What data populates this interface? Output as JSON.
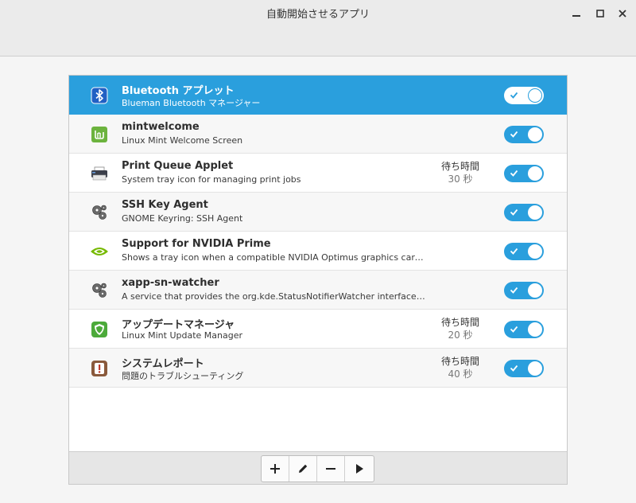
{
  "window": {
    "title": "自動開始させるアプリ",
    "buttons": {
      "minimize_icon": "minimize-icon",
      "maximize_icon": "maximize-icon",
      "close_icon": "close-icon"
    }
  },
  "apps": [
    {
      "name": "Bluetooth アプレット",
      "description": "Blueman Bluetooth マネージャー",
      "icon": "bluetooth-icon",
      "enabled": true,
      "selected": true
    },
    {
      "name": "mintwelcome",
      "description": "Linux Mint Welcome Screen",
      "icon": "mintwelcome-icon",
      "enabled": true
    },
    {
      "name": "Print Queue Applet",
      "description": "System tray icon for managing print jobs",
      "icon": "printer-icon",
      "enabled": true,
      "delay_label": "待ち時間",
      "delay_value": "30 秒"
    },
    {
      "name": "SSH Key Agent",
      "description": "GNOME Keyring: SSH Agent",
      "icon": "gears-icon",
      "enabled": true
    },
    {
      "name": "Support for NVIDIA Prime",
      "description": "Shows a tray icon when a compatible NVIDIA Optimus graphics card is de…",
      "icon": "nvidia-icon",
      "enabled": true
    },
    {
      "name": "xapp-sn-watcher",
      "description": "A service that provides the org.kde.StatusNotifierWatcher interface for XA…",
      "icon": "gears-icon",
      "enabled": true
    },
    {
      "name": "アップデートマネージャ",
      "description": "Linux Mint Update Manager",
      "icon": "shield-icon",
      "enabled": true,
      "delay_label": "待ち時間",
      "delay_value": "20 秒"
    },
    {
      "name": "システムレポート",
      "description": "問題のトラブルシューティング",
      "icon": "system-report-icon",
      "enabled": true,
      "delay_label": "待ち時間",
      "delay_value": "40 秒"
    }
  ],
  "toolbar": {
    "add_icon": "plus-icon",
    "edit_icon": "pencil-icon",
    "remove_icon": "minus-icon",
    "run_icon": "play-icon"
  },
  "colors": {
    "accent": "#2a9fdd",
    "selected_row": "#2a9fdd"
  }
}
